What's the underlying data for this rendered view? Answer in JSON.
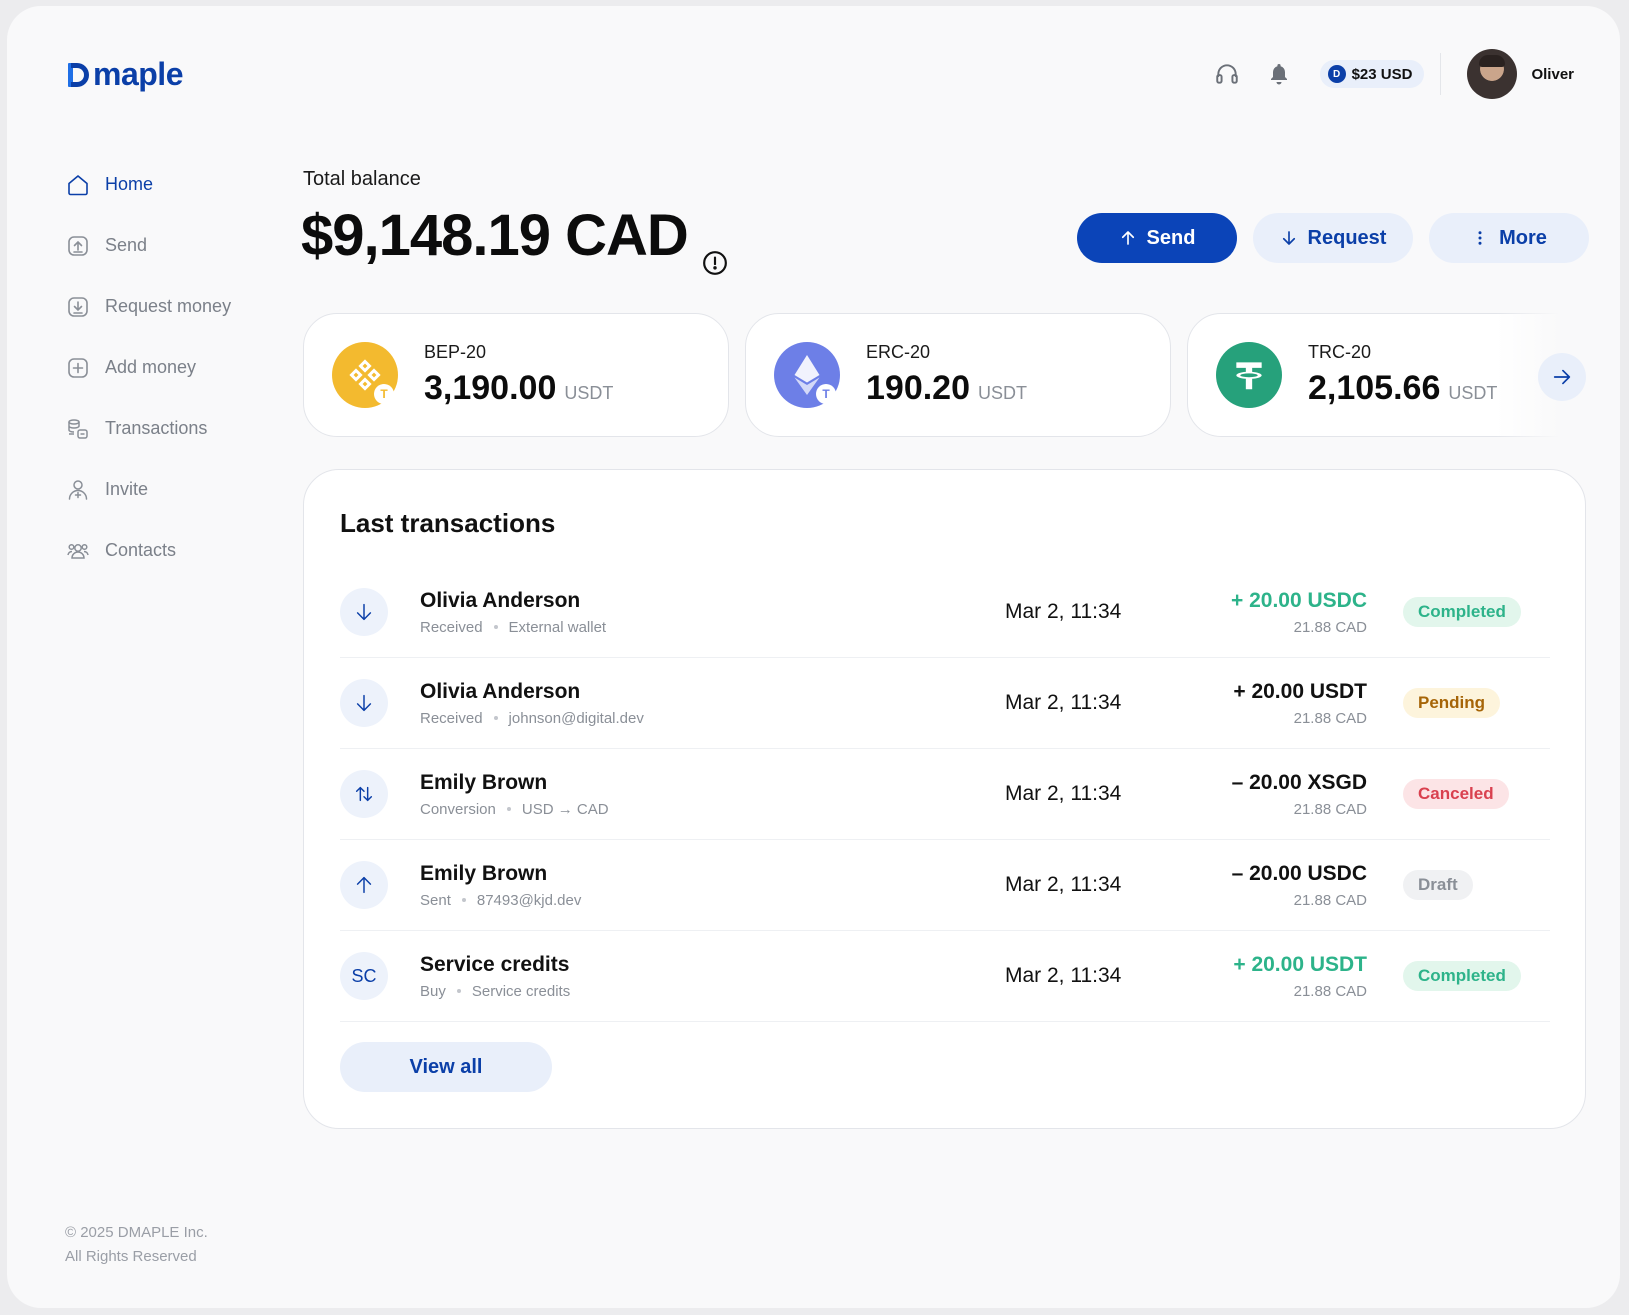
{
  "brand": {
    "logo_text": "maple"
  },
  "header": {
    "wallet_chip_icon": "D",
    "wallet_chip": "$23 USD",
    "user_name": "Oliver"
  },
  "sidebar": {
    "items": [
      {
        "label": "Home",
        "icon": "home-icon",
        "active": true
      },
      {
        "label": "Send",
        "icon": "send-icon",
        "active": false
      },
      {
        "label": "Request money",
        "icon": "request-icon",
        "active": false
      },
      {
        "label": "Add money",
        "icon": "add-icon",
        "active": false
      },
      {
        "label": "Transactions",
        "icon": "transactions-icon",
        "active": false
      },
      {
        "label": "Invite",
        "icon": "invite-icon",
        "active": false
      },
      {
        "label": "Contacts",
        "icon": "contacts-icon",
        "active": false
      }
    ],
    "footer_line1": "© 2025 DMAPLE Inc.",
    "footer_line2": "All Rights Reserved"
  },
  "balance": {
    "label": "Total balance",
    "amount": "$9,148.19 CAD"
  },
  "actions": {
    "send": "Send",
    "request": "Request",
    "more": "More"
  },
  "wallets": [
    {
      "network": "BEP-20",
      "amount": "3,190.00",
      "unit": "USDT",
      "icon": "binance-icon",
      "color": "#f3ba2f"
    },
    {
      "network": "ERC-20",
      "amount": "190.20",
      "unit": "USDT",
      "icon": "ethereum-icon",
      "color": "#6d7fe7"
    },
    {
      "network": "TRC-20",
      "amount": "2,105.66",
      "unit": "USDT",
      "icon": "tether-icon",
      "color": "#26a17b"
    }
  ],
  "transactions": {
    "title": "Last transactions",
    "rows": [
      {
        "icon": "arrow-down-icon",
        "name": "Olivia Anderson",
        "type": "Received",
        "detail": "External wallet",
        "date": "Mar 2, 11:34",
        "amount": "+ 20.00 USDC",
        "positive_color": true,
        "cad": "21.88 CAD",
        "status": "Completed",
        "status_class": "b-completed"
      },
      {
        "icon": "arrow-down-icon",
        "name": "Olivia Anderson",
        "type": "Received",
        "detail": "johnson@digital.dev",
        "date": "Mar 2, 11:34",
        "amount": "+ 20.00 USDT",
        "positive_color": false,
        "cad": "21.88 CAD",
        "status": "Pending",
        "status_class": "b-pending"
      },
      {
        "icon": "swap-icon",
        "name": "Emily Brown",
        "type": "Conversion",
        "detail": "USD → CAD",
        "date": "Mar 2, 11:34",
        "amount": "– 20.00 XSGD",
        "positive_color": false,
        "cad": "21.88 CAD",
        "status": "Canceled",
        "status_class": "b-canceled"
      },
      {
        "icon": "arrow-up-icon",
        "name": "Emily Brown",
        "type": "Sent",
        "detail": "87493@kjd.dev",
        "date": "Mar 2, 11:34",
        "amount": "– 20.00 USDC",
        "positive_color": false,
        "cad": "21.88 CAD",
        "status": "Draft",
        "status_class": "b-draft"
      },
      {
        "icon": "SC",
        "name": "Service credits",
        "type": "Buy",
        "detail": "Service credits",
        "date": "Mar 2, 11:34",
        "amount": "+ 20.00 USDT",
        "positive_color": true,
        "cad": "21.88 CAD",
        "status": "Completed",
        "status_class": "b-completed"
      }
    ],
    "view_all": "View all"
  }
}
